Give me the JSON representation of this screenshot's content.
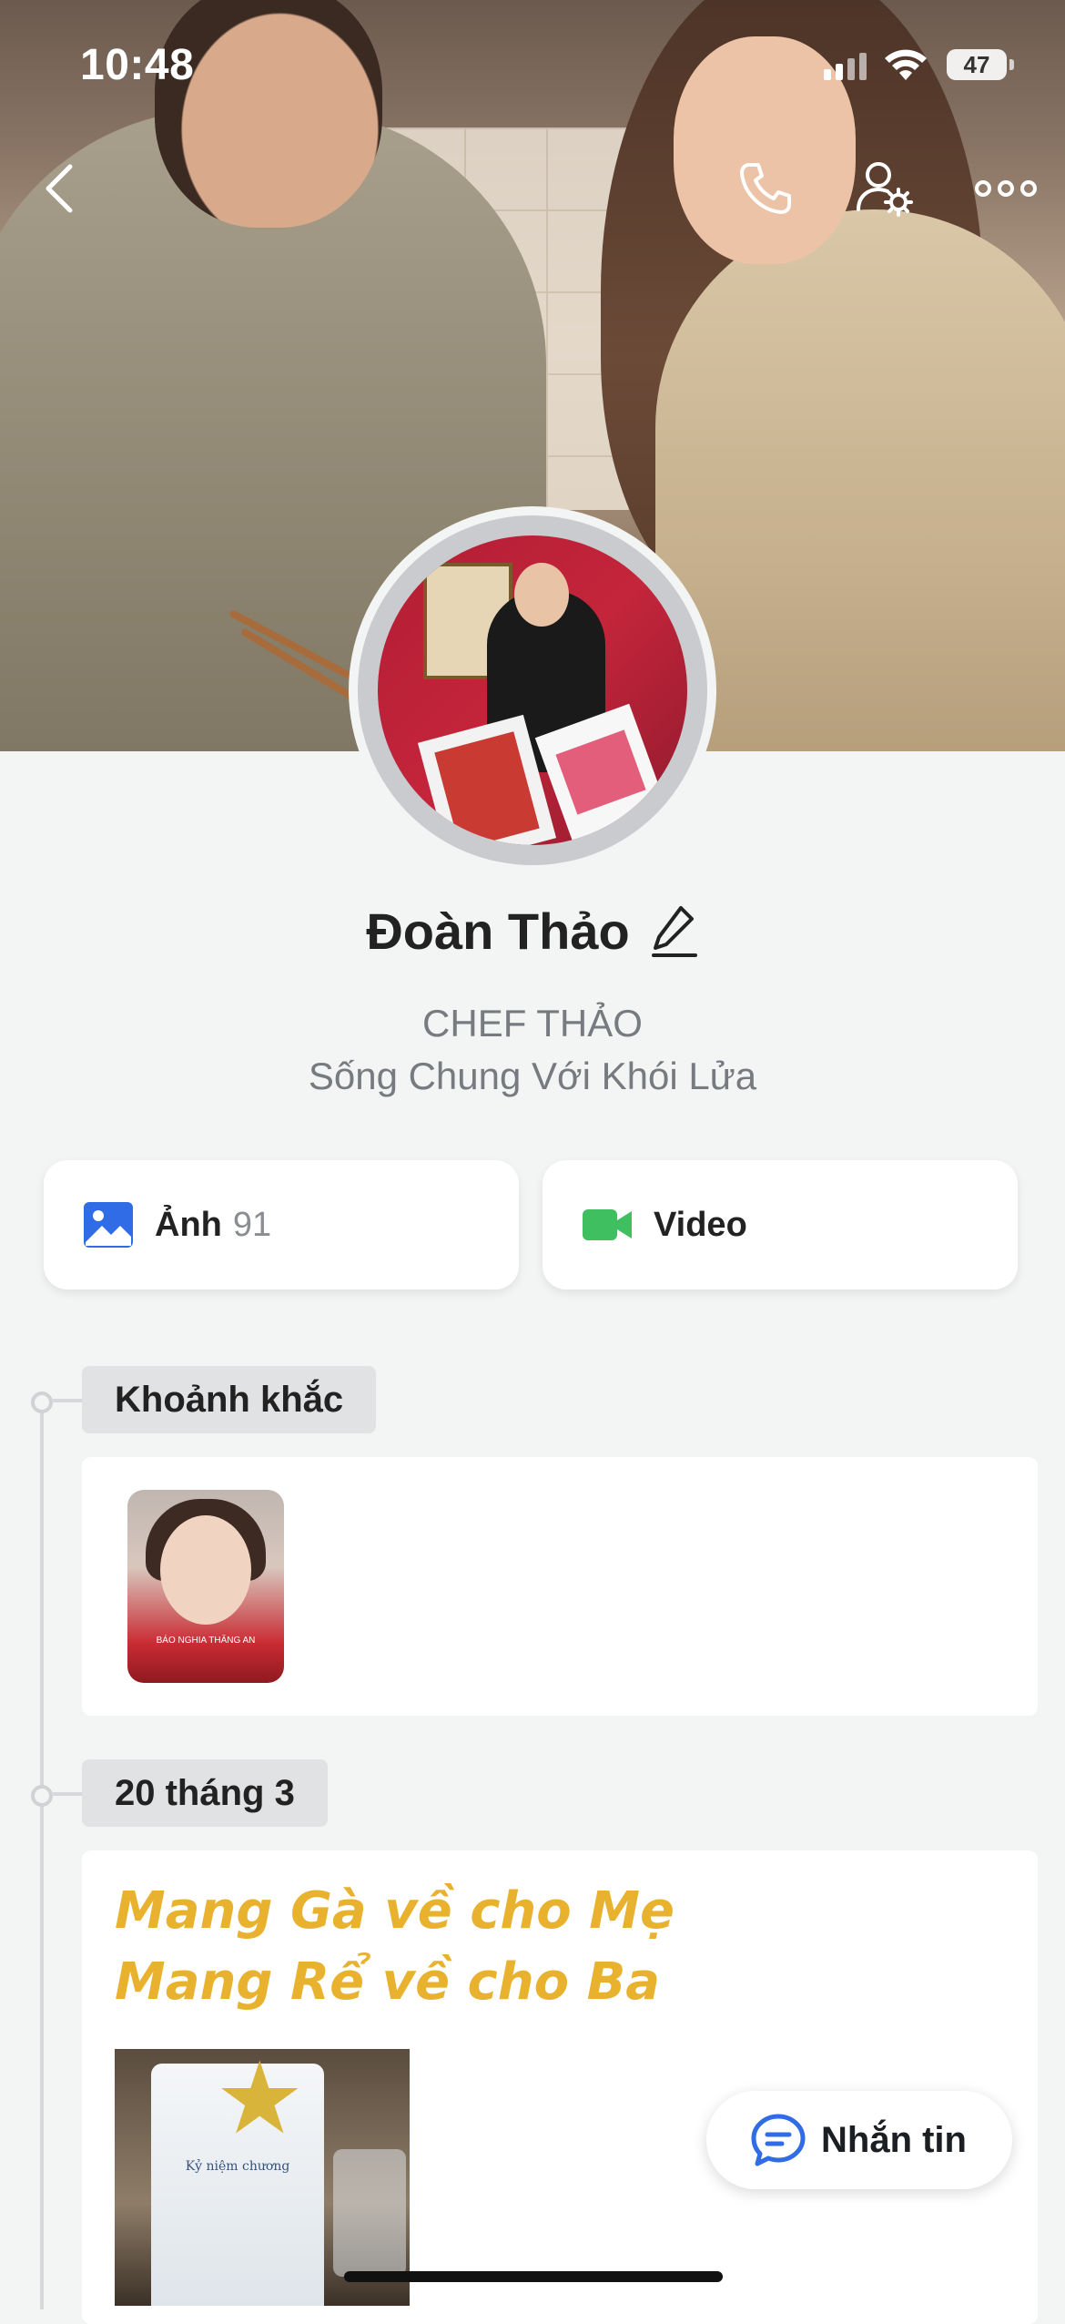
{
  "status_bar": {
    "time": "10:48",
    "battery": "47"
  },
  "profile": {
    "name": "Đoàn Thảo",
    "subtitle_1": "CHEF THẢO",
    "subtitle_2": "Sống Chung Với Khói Lửa"
  },
  "media": {
    "photos_label": "Ảnh",
    "photos_count": "91",
    "video_label": "Video"
  },
  "timeline": {
    "moments_label": "Khoảnh khắc",
    "moment_caption": "BÁO NGHIA THĂNG AN",
    "date_label": "20 tháng 3",
    "post_line_1": "Mang Gà về cho Mẹ",
    "post_line_2": "Mang Rể về cho Ba",
    "trophy_text": "Kỷ niệm chương"
  },
  "actions": {
    "message_label": "Nhắn tin"
  },
  "icons": [
    "back-icon",
    "phone-icon",
    "user-settings-icon",
    "more-icon",
    "edit-icon",
    "image-icon",
    "video-icon",
    "chat-icon"
  ],
  "colors": {
    "accent_blue": "#2f6ce5",
    "video_green": "#3fbf5f",
    "post_yellow": "#e8b22f"
  }
}
